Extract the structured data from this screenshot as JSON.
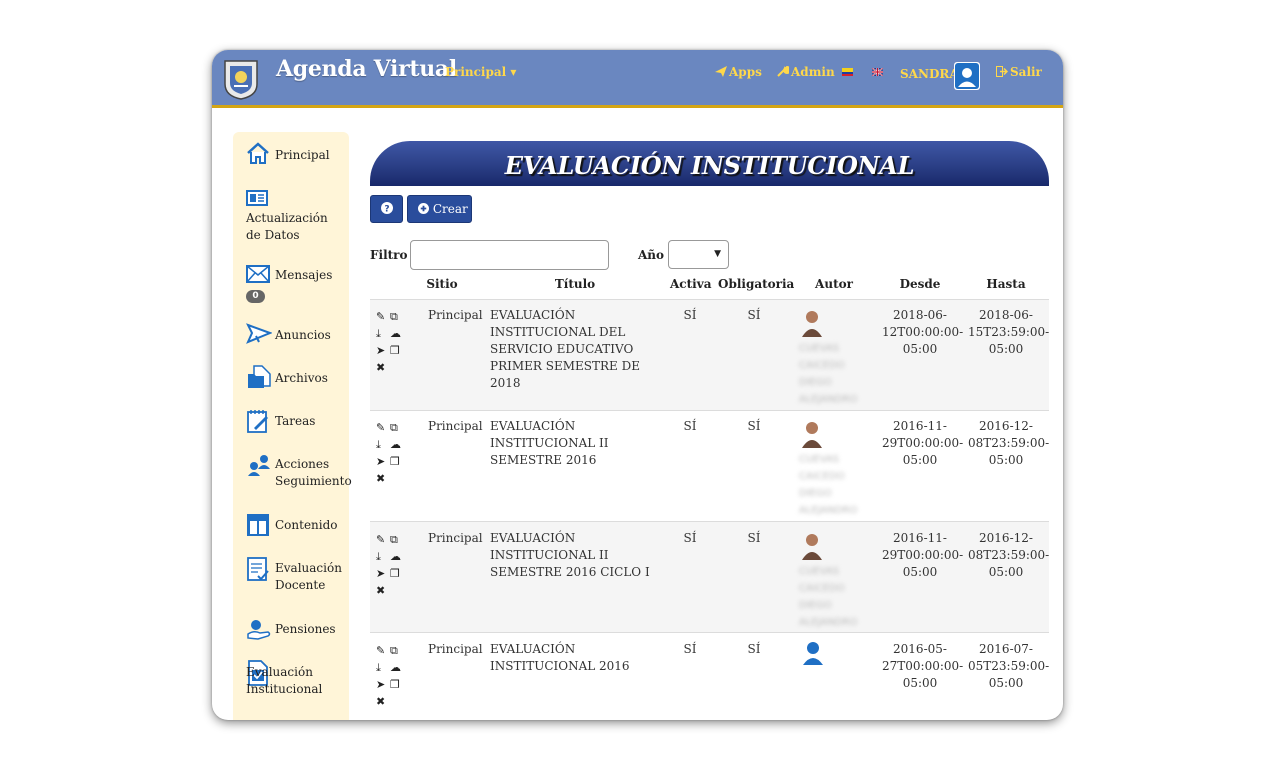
{
  "app": {
    "title": "Agenda Virtual",
    "nav_principal": "Principal ▾",
    "apps_label": "Apps",
    "admin_label": "Admin",
    "user_name": "SANDRA",
    "logout_label": "Salir"
  },
  "sidebar": {
    "items": [
      {
        "label": "Principal"
      },
      {
        "label": "Actualización de Datos"
      },
      {
        "label": "Mensajes",
        "badge": "0"
      },
      {
        "label": "Anuncios"
      },
      {
        "label": "Archivos"
      },
      {
        "label": "Tareas"
      },
      {
        "label": "Acciones Seguimiento"
      },
      {
        "label": "Contenido"
      },
      {
        "label": "Evaluación Docente"
      },
      {
        "label": "Pensiones"
      },
      {
        "label": "Evaluación Institucional"
      }
    ]
  },
  "main": {
    "page_title": "EVALUACIÓN INSTITUCIONAL",
    "help_icon": "question-circle-icon",
    "create_label": "Crear",
    "filter_label": "Filtro",
    "filter_value": "",
    "year_label": "Año",
    "year_value": "",
    "columns": [
      "Sitio",
      "Título",
      "Activa",
      "Obligatoria",
      "Autor",
      "Desde",
      "Hasta"
    ],
    "rows": [
      {
        "sitio": "Principal",
        "titulo": "EVALUACIÓN INSTITUCIONAL DEL SERVICIO EDUCATIVO PRIMER SEMESTRE DE 2018",
        "activa": "SÍ",
        "obligatoria": "SÍ",
        "autor": "CUEVAS CAICEDO DIEGO ALEJANDRO",
        "desde": "2018-06-12T00:00:00-05:00",
        "hasta": "2018-06-15T23:59:00-05:00"
      },
      {
        "sitio": "Principal",
        "titulo": "EVALUACIÓN INSTITUCIONAL II SEMESTRE 2016",
        "activa": "SÍ",
        "obligatoria": "SÍ",
        "autor": "CUEVAS CAICEDO DIEGO ALEJANDRO",
        "desde": "2016-11-29T00:00:00-05:00",
        "hasta": "2016-12-08T23:59:00-05:00"
      },
      {
        "sitio": "Principal",
        "titulo": "EVALUACIÓN INSTITUCIONAL II SEMESTRE 2016 CICLO I",
        "activa": "SÍ",
        "obligatoria": "SÍ",
        "autor": "CUEVAS CAICEDO DIEGO ALEJANDRO",
        "desde": "2016-11-29T00:00:00-05:00",
        "hasta": "2016-12-08T23:59:00-05:00"
      },
      {
        "sitio": "Principal",
        "titulo": "EVALUACIÓN INSTITUCIONAL 2016",
        "activa": "SÍ",
        "obligatoria": "SÍ",
        "autor": "",
        "desde": "2016-05-27T00:00:00-05:00",
        "hasta": "2016-07-05T23:59:00-05:00"
      }
    ]
  },
  "colors": {
    "topbar": "#6a87c0",
    "accent_gold": "#ffd84a",
    "button_blue": "#2a4d9c",
    "sidebar_bg": "#fff5d8",
    "icon_blue": "#1f6fc4"
  }
}
